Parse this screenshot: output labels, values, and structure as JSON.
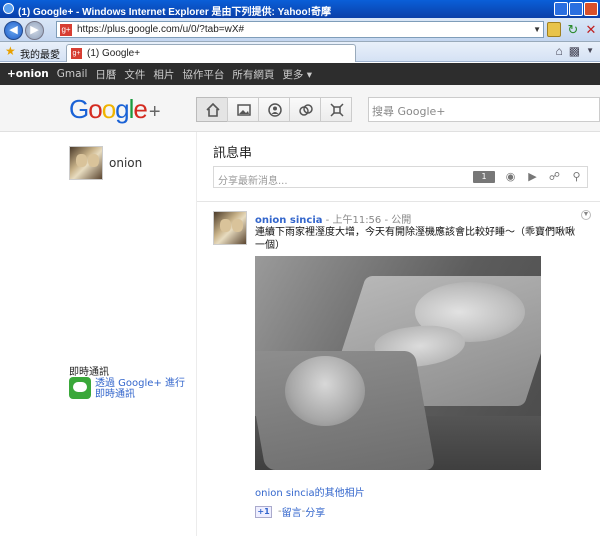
{
  "window": {
    "title": "(1) Google+ - Windows Internet Explorer 是由下列提供: Yahoo!奇摩"
  },
  "address": {
    "url": "https://plus.google.com/u/0/?tab=wX#"
  },
  "favorites": {
    "label": "我的最愛"
  },
  "tab": {
    "label": "(1) Google+",
    "favicon": "g+"
  },
  "gbar": {
    "items": [
      "+onion",
      "Gmail",
      "日曆",
      "文件",
      "相片",
      "協作平台",
      "所有網頁",
      "更多 ▾"
    ]
  },
  "header": {
    "logo_letters": [
      "G",
      "o",
      "o",
      "g",
      "l",
      "e"
    ],
    "logo_plus": "+",
    "search_placeholder": "搜尋  Google+"
  },
  "profile": {
    "name": "onion"
  },
  "chat": {
    "heading": "即時通訊",
    "link_line1": "透過 Google+ 進行",
    "link_line2": "即時通訊"
  },
  "stream": {
    "title": "訊息串",
    "share_placeholder": "分享最新消息...",
    "share_photo_icon_text": "1"
  },
  "post": {
    "author": "onion sincia",
    "separator": " - ",
    "time": "上午11:56",
    "visibility": "公開",
    "text": "連續下雨家裡溼度大增，今天有開除溼機應該會比較好睡～（乖寶們啾啾一個）",
    "more_photos_author": "onion sincia",
    "more_photos_rest": "的其他相片",
    "plusone": "+1",
    "comment": "留言",
    "share": "分享"
  },
  "colors": {
    "accent": "#3366cc",
    "gbar_bg": "#2d2d2d",
    "logo_blue": "#1a62d6",
    "logo_red": "#d42b20",
    "logo_yellow": "#f0b400",
    "logo_green": "#1b9a3e"
  },
  "icons": [
    "ie-icon",
    "back-icon",
    "forward-icon",
    "lock-icon",
    "refresh-icon",
    "stop-icon",
    "star-icon",
    "home-icon",
    "feed-icon",
    "photos-icon",
    "profile-icon",
    "circles-icon",
    "games-icon",
    "camera-icon",
    "video-icon",
    "link-icon",
    "location-icon",
    "chat-icon"
  ]
}
